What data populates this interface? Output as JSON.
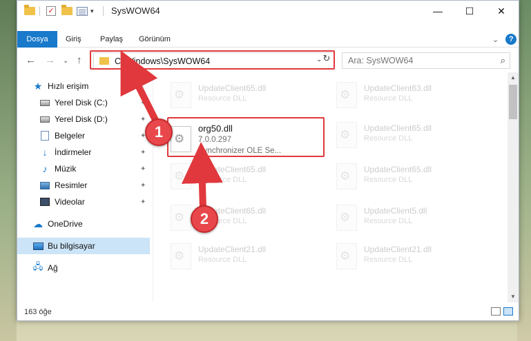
{
  "window": {
    "title": "SysWOW64",
    "minimize": "—",
    "maximize": "☐",
    "close": "✕"
  },
  "ribbon": {
    "tabs": [
      "Dosya",
      "Giriş",
      "Paylaş",
      "Görünüm"
    ],
    "help": "?"
  },
  "nav": {
    "back": "←",
    "forward": "→",
    "recent": "⌄",
    "up": "↑",
    "address": "C:\\Windows\\SysWOW64",
    "refresh": "↻",
    "search_placeholder": "Ara: SysWOW64"
  },
  "sidebar": {
    "items": [
      {
        "label": "Hızlı erişim",
        "icon": "star-icon"
      },
      {
        "label": "Yerel Disk (C:)",
        "icon": "drive-icon"
      },
      {
        "label": "Yerel Disk (D:)",
        "icon": "drive-icon"
      },
      {
        "label": "Belgeler",
        "icon": "documents-icon"
      },
      {
        "label": "İndirmeler",
        "icon": "downloads-icon"
      },
      {
        "label": "Müzik",
        "icon": "music-icon"
      },
      {
        "label": "Resimler",
        "icon": "pictures-icon"
      },
      {
        "label": "Videolar",
        "icon": "videos-icon"
      },
      {
        "label": "OneDrive",
        "icon": "onedrive-icon"
      },
      {
        "label": "Bu bilgisayar",
        "icon": "computer-icon"
      },
      {
        "label": "Ağ",
        "icon": "network-icon"
      }
    ]
  },
  "files": {
    "left": [
      {
        "name": "UpdateClient65.dll",
        "desc": "Resource DLL"
      },
      {
        "name": "org50.dll",
        "version": "7.0.0.297",
        "desc": "Synchronizer OLE Se..."
      },
      {
        "name": "UpdateClient65.dll",
        "desc": "Resource DLL"
      },
      {
        "name": "UpdateClient65.dll",
        "desc": "Resource DLL"
      },
      {
        "name": "UpdateClient21.dll",
        "desc": "Resource DLL"
      }
    ],
    "right": [
      {
        "name": "UpdateClient63.dll",
        "desc": "Resource DLL"
      },
      {
        "name": "UpdateClient65.dll",
        "desc": "Resource DLL"
      },
      {
        "name": "UpdateClient65.dll",
        "desc": "Resource DLL"
      },
      {
        "name": "UpdateClient5.dll",
        "desc": "Resource DLL"
      },
      {
        "name": "UpdateClient21.dll",
        "desc": "Resource DLL"
      }
    ]
  },
  "status": {
    "count": "163 öğe"
  },
  "annotations": {
    "step1": "1",
    "step2": "2",
    "color": "#e0383c"
  }
}
